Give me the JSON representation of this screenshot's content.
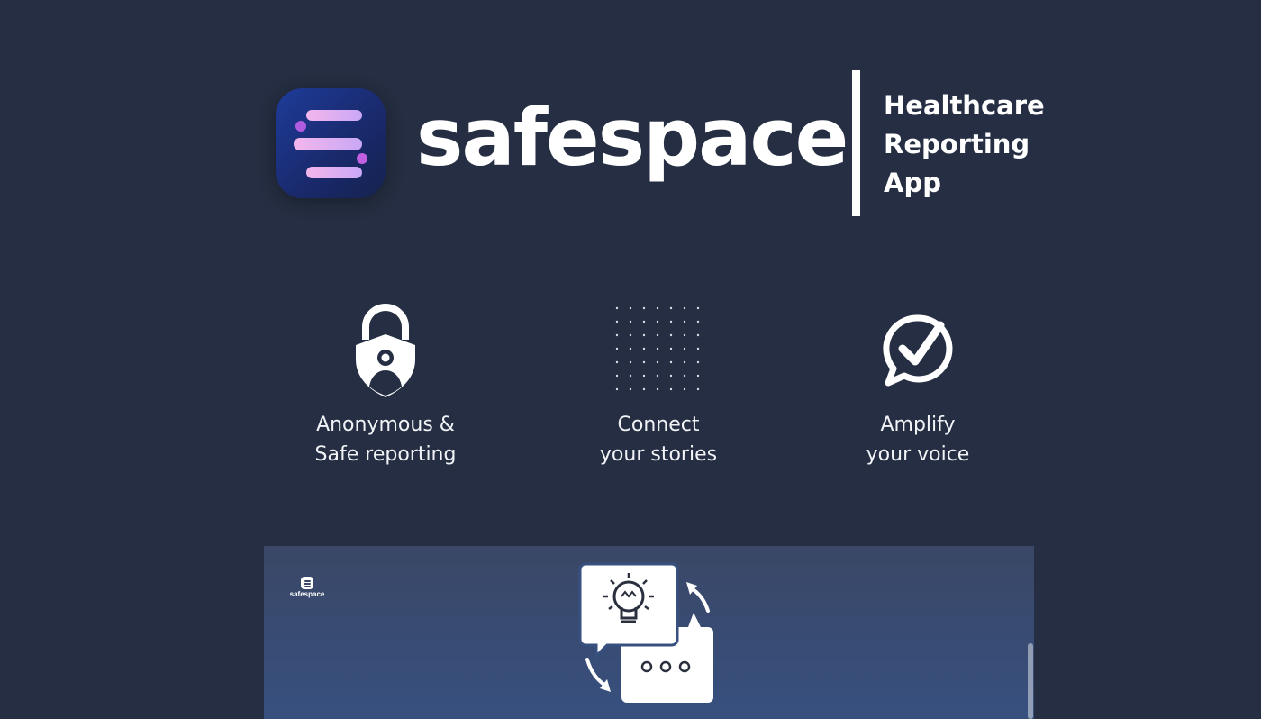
{
  "header": {
    "brand_name": "safespace",
    "tagline_lines": [
      "Healthcare",
      "Reporting",
      "App"
    ]
  },
  "features": [
    {
      "icon": "lock-shield-user-icon",
      "caption_lines": [
        "Anonymous &",
        "Safe reporting"
      ]
    },
    {
      "icon": "dot-grid-icon",
      "caption_lines": [
        "Connect",
        "your stories"
      ]
    },
    {
      "icon": "chat-check-icon",
      "caption_lines": [
        "Amplify",
        "your voice"
      ]
    }
  ],
  "panel": {
    "mini_logo_text": "safespace",
    "illustration_icon": "idea-exchange-icon"
  },
  "colors": {
    "background": "#252e42",
    "panel_top": "#3a4766",
    "panel_bottom": "#37507f",
    "brand_gradient_start": "#1e3c9a",
    "bar_accent": "#e8a8f0"
  }
}
